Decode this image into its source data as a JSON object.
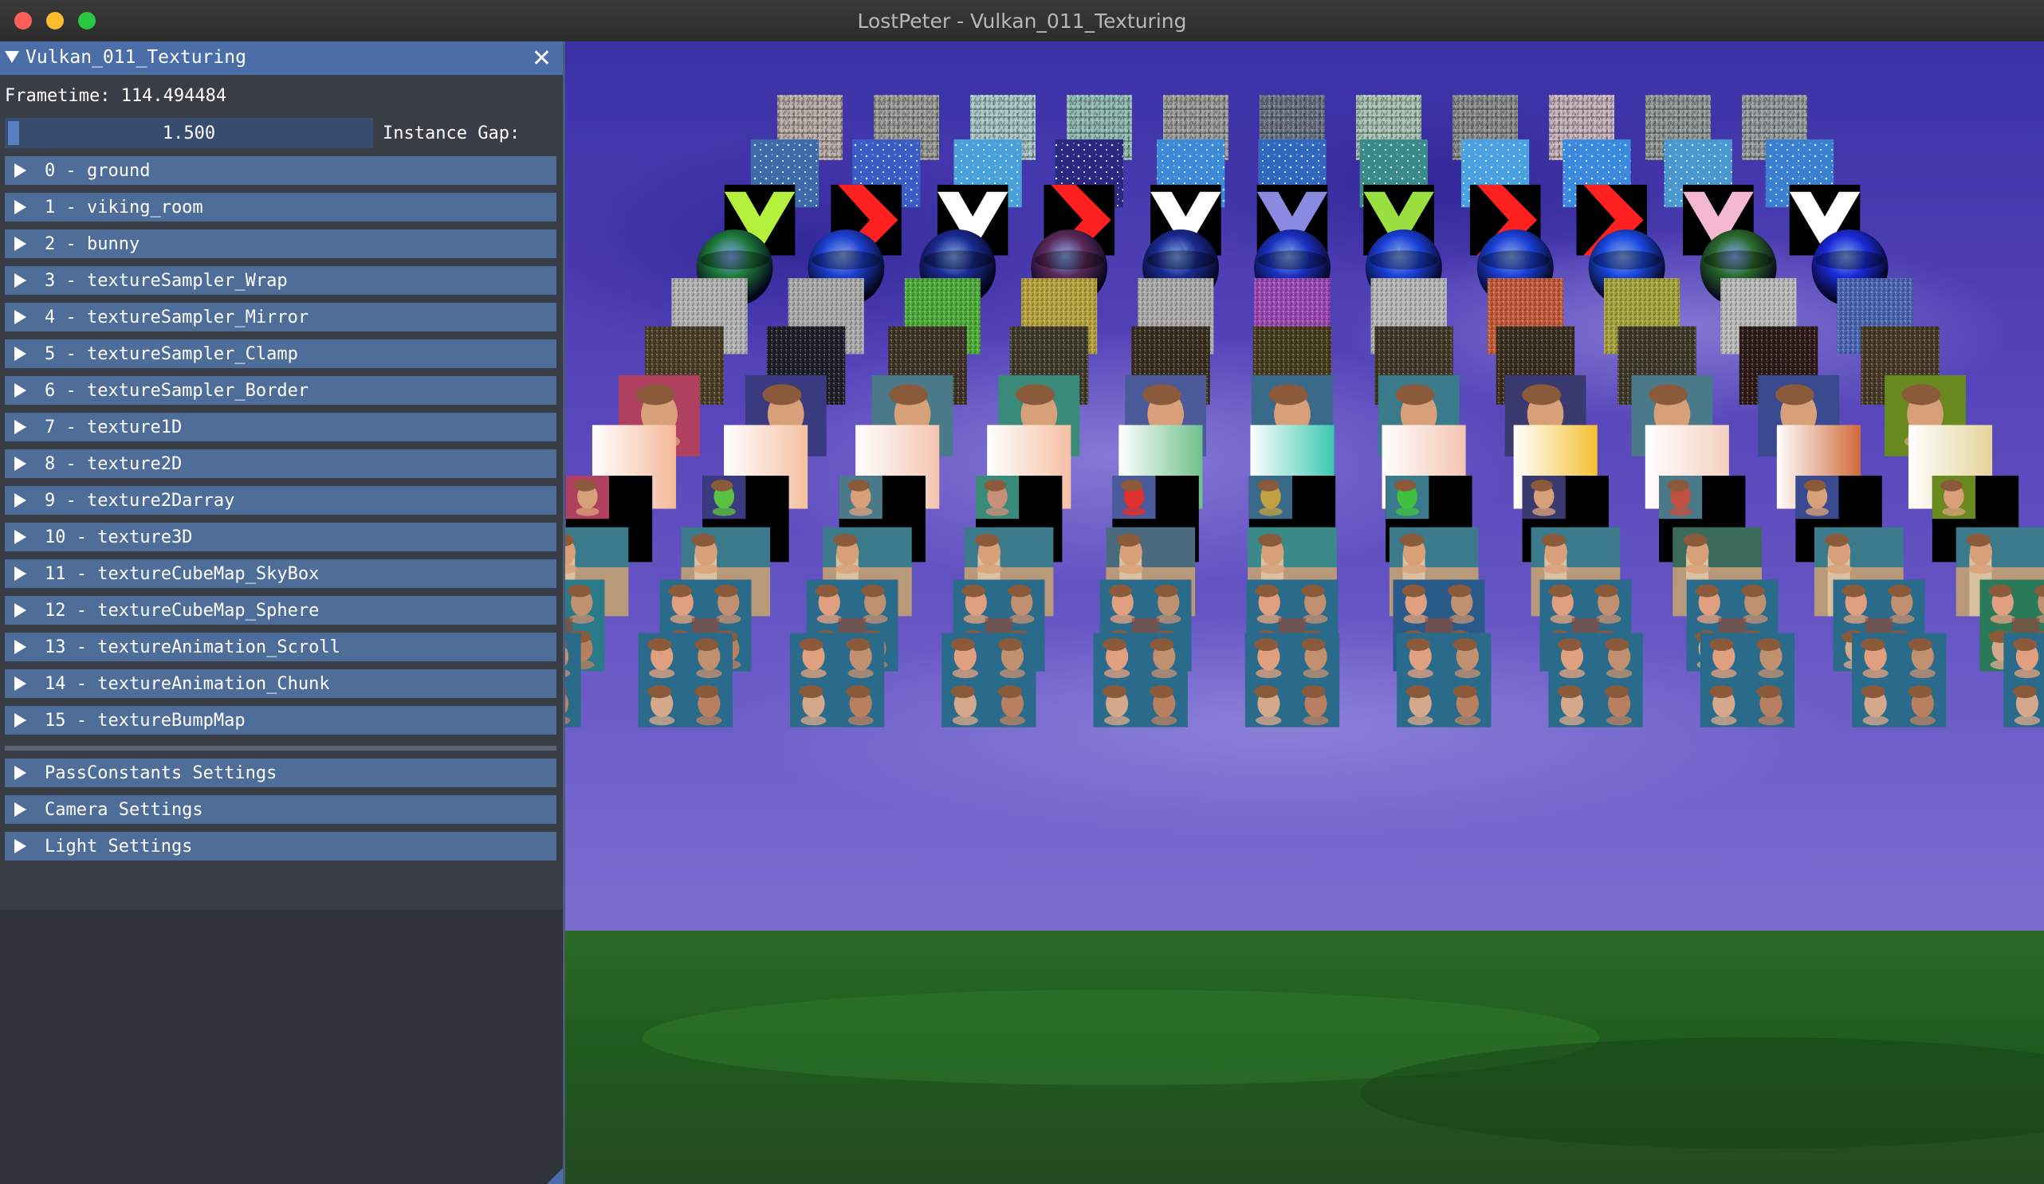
{
  "window": {
    "title": "LostPeter - Vulkan_011_Texturing"
  },
  "panel": {
    "title": "Vulkan_011_Texturing",
    "close_symbol": "✕",
    "frametime": "Frametime: 114.494484",
    "instance_gap_value": "1.500",
    "instance_gap_label": "Instance Gap:",
    "items": [
      "0 - ground",
      "1 - viking_room",
      "2 - bunny",
      "3 - textureSampler_Wrap",
      "4 - textureSampler_Mirror",
      "5 - textureSampler_Clamp",
      "6 - textureSampler_Border",
      "7 - texture1D",
      "8 - texture2D",
      "9 - texture2Darray",
      "10 - texture3D",
      "11 - textureCubeMap_SkyBox",
      "12 - textureCubeMap_Sphere",
      "13 - textureAnimation_Scroll",
      "14 - textureAnimation_Chunk",
      "15 - textureBumpMap"
    ],
    "settings": [
      "PassConstants Settings",
      "Camera Settings",
      "Light Settings"
    ]
  },
  "scene": {
    "icons": {
      "collapse_arrow": "triangle-down-icon",
      "expand_arrow": "triangle-right-icon"
    },
    "colors": {
      "sky_top": "#3a32a8",
      "sky_mid": "#6a56c4",
      "ground": "#1f5a1e"
    },
    "rows": [
      {
        "kind": "bricks",
        "colors": [
          "#b7a9a4",
          "#9a9a96",
          "#a6c4c4",
          "#8fb8b0",
          "#9a9a98",
          "#6a7384",
          "#a6c0b2",
          "#8a8c8c",
          "#c4b0b8",
          "#8f9794",
          "#959b9b"
        ]
      },
      {
        "kind": "stars",
        "colors": [
          "#3d6aa8",
          "#3a5cc4",
          "#4aa0d8",
          "#2a2880",
          "#3c8ad8",
          "#3068c0",
          "#3a8a8a",
          "#4aa0e0",
          "#3c8ae0",
          "#4a98d0",
          "#3a80d0"
        ]
      },
      {
        "kind": "chevrons",
        "bgs": [
          "#000",
          "#000",
          "#000",
          "#000",
          "#000",
          "#000",
          "#000",
          "#000",
          "#000",
          "#000",
          "#000"
        ],
        "fgs": [
          "#b4f03c",
          "#ff2020",
          "#ffffff",
          "#ff2020",
          "#ffffff",
          "#8a8ae0",
          "#9ae040",
          "#ff2020",
          "#ff2020",
          "#f4b8d0",
          "#ffffff"
        ],
        "dirs": [
          "d",
          "r",
          "d",
          "r",
          "d",
          "d",
          "d",
          "r",
          "r",
          "d",
          "d"
        ]
      },
      {
        "kind": "spheres",
        "colors": [
          "#1e7a3a",
          "#1d3fd0",
          "#1a2a90",
          "#5a2a5a",
          "#1a2a90",
          "#1a30c0",
          "#1a40d8",
          "#1a40d8",
          "#1a48e0",
          "#2a6a2a",
          "#1a2ad8"
        ]
      },
      {
        "kind": "noise",
        "colors": [
          "#b0b0b0",
          "#a8a8a8",
          "#4caa3a",
          "#b4a03c",
          "#a8a8a8",
          "#9a46b0",
          "#b4b4b4",
          "#c05a3a",
          "#a4a03c",
          "#b8b8b8",
          "#4a64b0"
        ]
      },
      {
        "kind": "dirt",
        "colors": [
          "#4a3e28",
          "#1e1e28",
          "#3e3426",
          "#403a2a",
          "#382e20",
          "#463c20",
          "#403828",
          "#3a2e1e",
          "#3e3828",
          "#2e1a18",
          "#463a26"
        ]
      },
      {
        "kind": "portrait",
        "colors": [
          "#b04060",
          "#3a3a80",
          "#4a7a8a",
          "#3a8a7a",
          "#4a5a9a",
          "#3a6a8a",
          "#3a7a8a",
          "#3a3a70",
          "#4a7a8a",
          "#3a4a90",
          "#6a8a20"
        ]
      },
      {
        "kind": "gradient",
        "colors": [
          "#f4b89a",
          "#f4c0a0",
          "#f4c4b0",
          "#f4c0a4",
          "#6ec08a",
          "#3ac8b0",
          "#f4c4b0",
          "#f4c030",
          "#f4d0c0",
          "#d06a3a",
          "#e4d49a"
        ]
      },
      {
        "kind": "portrait_small",
        "colors": [
          "#000",
          "#000",
          "#000",
          "#000",
          "#000",
          "#000",
          "#000",
          "#000",
          "#000",
          "#000",
          "#000"
        ]
      },
      {
        "kind": "wall",
        "colors": [
          "#3a7a8a",
          "#3a7a8a",
          "#3a7a8a",
          "#3a7a8a",
          "#4a6a80",
          "#3a8a8a",
          "#3a7a8a",
          "#3a7a8a",
          "#3a6a5a",
          "#3a7a8a",
          "#3a7a8a"
        ]
      },
      {
        "kind": "quad_mirror",
        "colors": [
          "#2a7a8a",
          "#2a6a8a",
          "#2a6a8a",
          "#2a6a8a",
          "#2a6a8a",
          "#2a6a8a",
          "#2a5a8a",
          "#2a6a8a",
          "#2a6a8a",
          "#2a6a8a",
          "#2a7a5a"
        ]
      },
      {
        "kind": "quad",
        "colors": [
          "#2a6a8a",
          "#2a6a8a",
          "#2a6a8a",
          "#2a6a8a",
          "#2a6a8a",
          "#2a6a8a",
          "#2a6a8a",
          "#2a6a8a",
          "#2a6a8a",
          "#2a6a8a",
          "#2a6a8a"
        ]
      }
    ]
  }
}
